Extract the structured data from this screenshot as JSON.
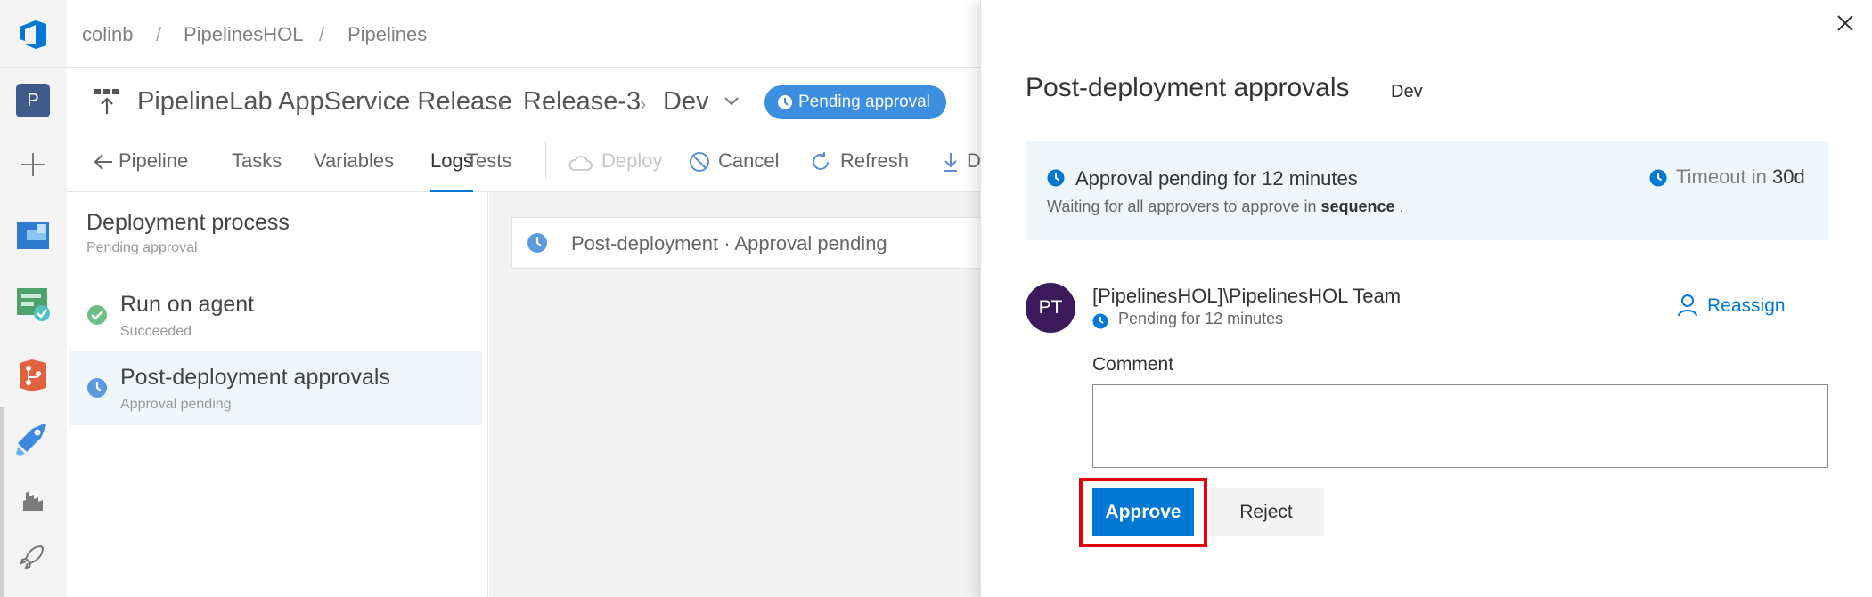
{
  "colors": {
    "accent": "#0078d4",
    "pending_badge": "#3b8ee0",
    "success": "#6cbf84",
    "highlight_box": "#e3000f",
    "avatar_bg": "#3a1a5a"
  },
  "nav_rail": {
    "project_initial": "P",
    "icons": [
      "azure-devops-logo-icon",
      "plus-icon",
      "boards-icon",
      "test-plans-icon",
      "repos-icon",
      "pipelines-icon",
      "artifacts-icon",
      "rocket-icon"
    ]
  },
  "breadcrumb": {
    "org": "colinb",
    "project": "PipelinesHOL",
    "section": "Pipelines",
    "separator": "/"
  },
  "release": {
    "pipeline_name": "PipelineLab AppService Release",
    "release_name": "Release-3",
    "environment": "Dev",
    "status_badge": "Pending approval"
  },
  "tabs": [
    {
      "label": "Pipeline"
    },
    {
      "label": "Tasks"
    },
    {
      "label": "Variables"
    },
    {
      "label": "Logs"
    },
    {
      "label": "Tests"
    }
  ],
  "commands": {
    "deploy": "Deploy",
    "cancel": "Cancel",
    "refresh": "Refresh",
    "download_partial": "D"
  },
  "process": {
    "title": "Deployment process",
    "subtitle": "Pending approval",
    "steps": [
      {
        "name": "Run on agent",
        "status": "Succeeded"
      },
      {
        "name": "Post-deployment approvals",
        "status": "Approval pending"
      }
    ]
  },
  "stage_card": {
    "text": "Post-deployment  ·  Approval pending"
  },
  "panel": {
    "title": "Post-deployment approvals",
    "environment": "Dev",
    "status_text": "Approval pending for 12 minutes",
    "waiting_prefix": "Waiting for all approvers to approve in",
    "waiting_mode": "sequence",
    "waiting_suffix": ".",
    "timeout_label": "Timeout in",
    "timeout_value": "30d",
    "approver": {
      "initials": "PT",
      "name": "[PipelinesHOL]\\PipelinesHOL Team",
      "status": "Pending for 12 minutes"
    },
    "reassign_label": "Reassign",
    "comment_label": "Comment",
    "comment_value": "",
    "approve_label": "Approve",
    "reject_label": "Reject"
  }
}
